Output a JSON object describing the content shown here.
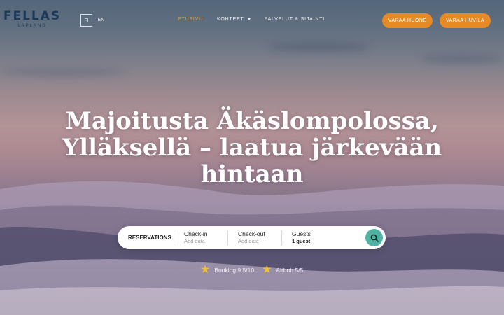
{
  "brand": {
    "name": "FELLAS",
    "sub": "LAPLAND"
  },
  "lang": {
    "fi": "FI",
    "en": "EN"
  },
  "nav": {
    "home": "ETUSIVU",
    "rooms": "KOHTEET",
    "services": "PALVELUT & SIJAINTI"
  },
  "cta": {
    "book_room": "VARAA HUONE",
    "book_villa": "VARAA HUVILA"
  },
  "hero": {
    "title": "Majoitusta Äkäslompolossa, Ylläksellä – laatua järkevään hintaan"
  },
  "booking": {
    "title": "RESERVATIONS",
    "checkin_label": "Check-in",
    "checkin_value": "Add date",
    "checkout_label": "Check-out",
    "checkout_value": "Add date",
    "guests_label": "Guests",
    "guests_value": "1 guest"
  },
  "ratings": {
    "booking": "Booking 9.5/10",
    "airbnb": "Airbnb 5/5"
  },
  "colors": {
    "accent": "#e58a24",
    "search": "#4fb3a3",
    "brand": "#1c3a5a",
    "star": "#f2c12e"
  },
  "icons": {
    "search": "search-icon",
    "star": "star-icon",
    "dropdown": "chevron-down-icon"
  }
}
